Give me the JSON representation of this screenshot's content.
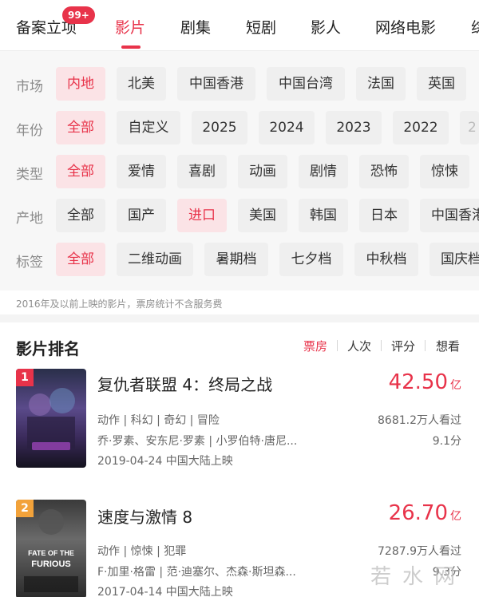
{
  "tabs": {
    "items": [
      {
        "label": "备案立项"
      },
      {
        "label": "影片"
      },
      {
        "label": "剧集"
      },
      {
        "label": "短剧"
      },
      {
        "label": "影人"
      },
      {
        "label": "网络电影"
      },
      {
        "label": "综"
      }
    ],
    "badge": "99+",
    "active": "影片"
  },
  "filters": {
    "market": {
      "label": "市场",
      "options": [
        "内地",
        "北美",
        "中国香港",
        "中国台湾",
        "法国",
        "英国"
      ],
      "selected": "内地"
    },
    "year": {
      "label": "年份",
      "options": [
        "全部",
        "自定义",
        "2025",
        "2024",
        "2023",
        "2022",
        "2"
      ],
      "selected": "全部"
    },
    "genre": {
      "label": "类型",
      "options": [
        "全部",
        "爱情",
        "喜剧",
        "动画",
        "剧情",
        "恐怖",
        "惊悚"
      ],
      "selected": "全部"
    },
    "origin": {
      "label": "产地",
      "options": [
        "全部",
        "国产",
        "进口",
        "美国",
        "韩国",
        "日本",
        "中国香港"
      ],
      "selected": "进口"
    },
    "tag": {
      "label": "标签",
      "options": [
        "全部",
        "二维动画",
        "暑期档",
        "七夕档",
        "中秋档",
        "国庆档"
      ],
      "selected": "全部"
    }
  },
  "note": "2016年及以前上映的影片，票房统计不含服务费",
  "ranking": {
    "title": "影片排名",
    "sort_options": [
      "票房",
      "人次",
      "评分",
      "想看"
    ],
    "sort_active": "票房"
  },
  "movies": [
    {
      "rank": "1",
      "title": "复仇者联盟 4：终局之战",
      "box_office": "42.50",
      "unit": "亿",
      "genres": "动作 | 科幻 | 奇幻 | 冒险",
      "cast": "乔·罗素、安东尼·罗素 | 小罗伯特·唐尼...",
      "release": "2019-04-24 中国大陆上映",
      "viewers": "8681.2万人看过",
      "score": "9.1分",
      "badge_color": "#e8334a"
    },
    {
      "rank": "2",
      "title": "速度与激情 8",
      "box_office": "26.70",
      "unit": "亿",
      "genres": "动作 | 惊悚 | 犯罪",
      "cast": "F·加里·格雷 | 范·迪塞尔、杰森·斯坦森...",
      "release": "2017-04-14 中国大陆上映",
      "viewers": "7287.9万人看过",
      "score": "9.3分",
      "badge_color": "#f2a23a"
    }
  ],
  "watermark": "若水网",
  "colors": {
    "accent": "#e8334a",
    "chip_bg": "#efefef",
    "chip_selected_bg": "#fbe3e6"
  }
}
